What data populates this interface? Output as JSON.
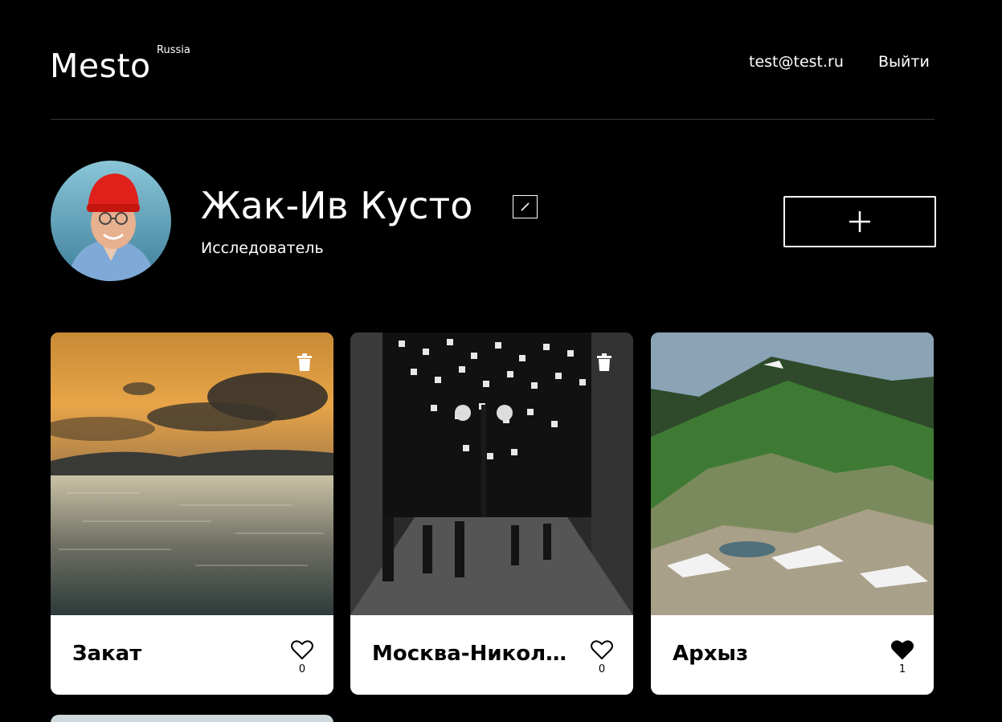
{
  "header": {
    "logo": "Mesto",
    "logo_sup": "Russia",
    "email": "test@test.ru",
    "logout": "Выйти"
  },
  "profile": {
    "name": "Жак-Ив Кусто",
    "about": "Исследователь"
  },
  "icons": {
    "edit": "pencil-icon",
    "add": "plus-icon",
    "delete": "trash-icon",
    "like": "heart-icon"
  },
  "colors": {
    "background": "#000000",
    "card": "#ffffff",
    "text_dark": "#000000"
  },
  "cards": [
    {
      "title": "Закат",
      "likes": "0",
      "liked": false,
      "deletable": true
    },
    {
      "title": "Москва-Никольская",
      "likes": "0",
      "liked": false,
      "deletable": true
    },
    {
      "title": "Архыз",
      "likes": "1",
      "liked": true,
      "deletable": false
    }
  ]
}
